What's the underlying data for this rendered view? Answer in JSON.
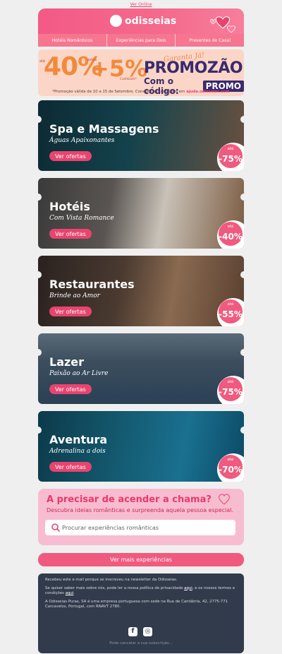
{
  "top_link": "Ver Online",
  "header": {
    "logo": "odisseias",
    "nav": [
      "Hotéis Românticos",
      "Experiências para Dois",
      "Presentes de Casal"
    ]
  },
  "promo": {
    "ate": "até",
    "big": "40%",
    "extra": "extra",
    "plus_value": "+5%",
    "cashback": "Cashback*",
    "garanta": "Garanta Já!",
    "title": "PROMOZÃO",
    "code_label": "Com o código:",
    "code": "PROMO",
    "note_text": "*Promoção válida de 10 a 15 de Setembro. Consulte as condições em ",
    "note_link": "ajuda.odisseias.com"
  },
  "cards": [
    {
      "title": "Spa e Massagens",
      "subtitle": "Águas Apaixonantes",
      "button": "Ver ofertas",
      "badge_ate": "até",
      "badge_value": "-75%"
    },
    {
      "title": "Hotéis",
      "subtitle": "Com Vista Romance",
      "button": "Ver ofertas",
      "badge_ate": "até",
      "badge_value": "-40%"
    },
    {
      "title": "Restaurantes",
      "subtitle": "Brinde ao Amor",
      "button": "Ver ofertas",
      "badge_ate": "até",
      "badge_value": "-55%"
    },
    {
      "title": "Lazer",
      "subtitle": "Paixão ao Ar Livre",
      "button": "Ver ofertas",
      "badge_ate": "até",
      "badge_value": "-75%"
    },
    {
      "title": "Aventura",
      "subtitle": "Adrenalina a dois",
      "button": "Ver ofertas",
      "badge_ate": "até",
      "badge_value": "-70%"
    }
  ],
  "search": {
    "title": "A precisar de acender a chama?",
    "subtitle": "Descubra ideias românticas e surpreenda aquela pessoa especial.",
    "placeholder": "Procurar experiências românticas"
  },
  "more_button": "Ver mais experiências",
  "footer": {
    "line1": "Recebeu este e-mail porque se inscreveu na newsletter da Odisseias.",
    "line2a": "Se quiser saber mais sobre nós, pode ler a nossa política de privacidade ",
    "line2_link1": "aqui",
    "line2b": ", e os nossos termos e condições ",
    "line2_link2": "aqui",
    "line3": "A Odisseias Puras, SA é uma empresa portuguesa com sede na Rua de Cantábria, 42, 2775-771 Carcavelos, Portugal, com RNAVT 2780.",
    "facebook": "f",
    "instagram": "◎",
    "unsubscribe": "Pode cancelar a sua subscrição..."
  }
}
